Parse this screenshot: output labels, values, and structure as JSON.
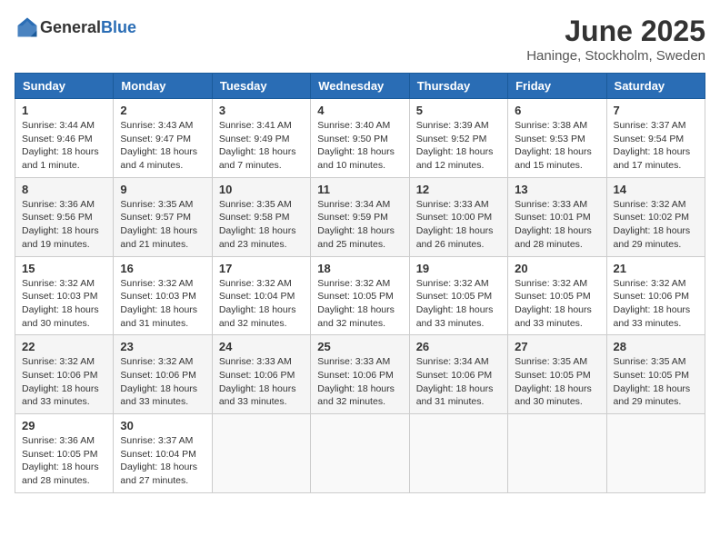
{
  "header": {
    "logo_general": "General",
    "logo_blue": "Blue",
    "title": "June 2025",
    "location": "Haninge, Stockholm, Sweden"
  },
  "weekdays": [
    "Sunday",
    "Monday",
    "Tuesday",
    "Wednesday",
    "Thursday",
    "Friday",
    "Saturday"
  ],
  "weeks": [
    [
      {
        "day": "1",
        "sunrise": "3:44 AM",
        "sunset": "9:46 PM",
        "daylight": "18 hours and 1 minute."
      },
      {
        "day": "2",
        "sunrise": "3:43 AM",
        "sunset": "9:47 PM",
        "daylight": "18 hours and 4 minutes."
      },
      {
        "day": "3",
        "sunrise": "3:41 AM",
        "sunset": "9:49 PM",
        "daylight": "18 hours and 7 minutes."
      },
      {
        "day": "4",
        "sunrise": "3:40 AM",
        "sunset": "9:50 PM",
        "daylight": "18 hours and 10 minutes."
      },
      {
        "day": "5",
        "sunrise": "3:39 AM",
        "sunset": "9:52 PM",
        "daylight": "18 hours and 12 minutes."
      },
      {
        "day": "6",
        "sunrise": "3:38 AM",
        "sunset": "9:53 PM",
        "daylight": "18 hours and 15 minutes."
      },
      {
        "day": "7",
        "sunrise": "3:37 AM",
        "sunset": "9:54 PM",
        "daylight": "18 hours and 17 minutes."
      }
    ],
    [
      {
        "day": "8",
        "sunrise": "3:36 AM",
        "sunset": "9:56 PM",
        "daylight": "18 hours and 19 minutes."
      },
      {
        "day": "9",
        "sunrise": "3:35 AM",
        "sunset": "9:57 PM",
        "daylight": "18 hours and 21 minutes."
      },
      {
        "day": "10",
        "sunrise": "3:35 AM",
        "sunset": "9:58 PM",
        "daylight": "18 hours and 23 minutes."
      },
      {
        "day": "11",
        "sunrise": "3:34 AM",
        "sunset": "9:59 PM",
        "daylight": "18 hours and 25 minutes."
      },
      {
        "day": "12",
        "sunrise": "3:33 AM",
        "sunset": "10:00 PM",
        "daylight": "18 hours and 26 minutes."
      },
      {
        "day": "13",
        "sunrise": "3:33 AM",
        "sunset": "10:01 PM",
        "daylight": "18 hours and 28 minutes."
      },
      {
        "day": "14",
        "sunrise": "3:32 AM",
        "sunset": "10:02 PM",
        "daylight": "18 hours and 29 minutes."
      }
    ],
    [
      {
        "day": "15",
        "sunrise": "3:32 AM",
        "sunset": "10:03 PM",
        "daylight": "18 hours and 30 minutes."
      },
      {
        "day": "16",
        "sunrise": "3:32 AM",
        "sunset": "10:03 PM",
        "daylight": "18 hours and 31 minutes."
      },
      {
        "day": "17",
        "sunrise": "3:32 AM",
        "sunset": "10:04 PM",
        "daylight": "18 hours and 32 minutes."
      },
      {
        "day": "18",
        "sunrise": "3:32 AM",
        "sunset": "10:05 PM",
        "daylight": "18 hours and 32 minutes."
      },
      {
        "day": "19",
        "sunrise": "3:32 AM",
        "sunset": "10:05 PM",
        "daylight": "18 hours and 33 minutes."
      },
      {
        "day": "20",
        "sunrise": "3:32 AM",
        "sunset": "10:05 PM",
        "daylight": "18 hours and 33 minutes."
      },
      {
        "day": "21",
        "sunrise": "3:32 AM",
        "sunset": "10:06 PM",
        "daylight": "18 hours and 33 minutes."
      }
    ],
    [
      {
        "day": "22",
        "sunrise": "3:32 AM",
        "sunset": "10:06 PM",
        "daylight": "18 hours and 33 minutes."
      },
      {
        "day": "23",
        "sunrise": "3:32 AM",
        "sunset": "10:06 PM",
        "daylight": "18 hours and 33 minutes."
      },
      {
        "day": "24",
        "sunrise": "3:33 AM",
        "sunset": "10:06 PM",
        "daylight": "18 hours and 33 minutes."
      },
      {
        "day": "25",
        "sunrise": "3:33 AM",
        "sunset": "10:06 PM",
        "daylight": "18 hours and 32 minutes."
      },
      {
        "day": "26",
        "sunrise": "3:34 AM",
        "sunset": "10:06 PM",
        "daylight": "18 hours and 31 minutes."
      },
      {
        "day": "27",
        "sunrise": "3:35 AM",
        "sunset": "10:05 PM",
        "daylight": "18 hours and 30 minutes."
      },
      {
        "day": "28",
        "sunrise": "3:35 AM",
        "sunset": "10:05 PM",
        "daylight": "18 hours and 29 minutes."
      }
    ],
    [
      {
        "day": "29",
        "sunrise": "3:36 AM",
        "sunset": "10:05 PM",
        "daylight": "18 hours and 28 minutes."
      },
      {
        "day": "30",
        "sunrise": "3:37 AM",
        "sunset": "10:04 PM",
        "daylight": "18 hours and 27 minutes."
      },
      null,
      null,
      null,
      null,
      null
    ]
  ],
  "labels": {
    "sunrise": "Sunrise:",
    "sunset": "Sunset:",
    "daylight": "Daylight:"
  }
}
